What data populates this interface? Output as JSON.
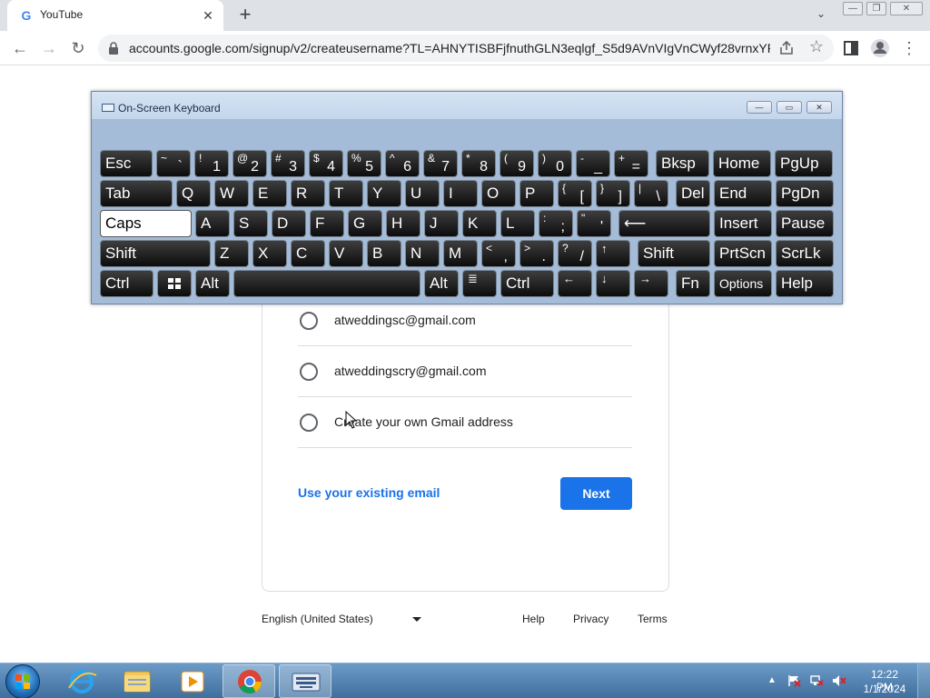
{
  "browser": {
    "tab": {
      "title": "YouTube",
      "favicon": "google-g-icon",
      "close": "✕"
    },
    "new_tab": "+",
    "tab_list": "⌄",
    "window_controls": {
      "minimize": "—",
      "restore": "❐",
      "close": "✕"
    },
    "url": "accounts.google.com/signup/v2/createusername?TL=AHNYTISBFjfnuthGLN3eqlgf_S5d9AVnVIgVnCWyf28vrnxYR...",
    "nav": {
      "back": "←",
      "forward": "→",
      "reload": "↻"
    },
    "star": "☆",
    "menu": "⋮"
  },
  "osk": {
    "title": "On-Screen Keyboard",
    "controls": {
      "minimize": "—",
      "restore": "▭",
      "close": "✕"
    },
    "rows": [
      [
        {
          "l": "Esc",
          "w": 58
        },
        {
          "s": "~",
          "u": "`",
          "w": 38
        },
        {
          "s": "!",
          "u": "1",
          "w": 38
        },
        {
          "s": "@",
          "u": "2",
          "w": 38
        },
        {
          "s": "#",
          "u": "3",
          "w": 38
        },
        {
          "s": "$",
          "u": "4",
          "w": 38
        },
        {
          "s": "%",
          "u": "5",
          "w": 38
        },
        {
          "s": "^",
          "u": "6",
          "w": 38
        },
        {
          "s": "&",
          "u": "7",
          "w": 38
        },
        {
          "s": "*",
          "u": "8",
          "w": 38
        },
        {
          "s": "(",
          "u": "9",
          "w": 38
        },
        {
          "s": ")",
          "u": "0",
          "w": 38
        },
        {
          "s": "-",
          "u": "_",
          "w": 38
        },
        {
          "s": "+",
          "u": "=",
          "w": 38
        },
        {
          "l": "Bksp",
          "w": 59,
          "gap": 4
        },
        {
          "l": "Home",
          "w": 64
        },
        {
          "l": "PgUp",
          "w": 64
        }
      ],
      [
        {
          "l": "Tab",
          "w": 80
        },
        {
          "l": "Q",
          "w": 38
        },
        {
          "l": "W",
          "w": 38
        },
        {
          "l": "E",
          "w": 38
        },
        {
          "l": "R",
          "w": 38
        },
        {
          "l": "T",
          "w": 38
        },
        {
          "l": "Y",
          "w": 38
        },
        {
          "l": "U",
          "w": 38
        },
        {
          "l": "I",
          "w": 38
        },
        {
          "l": "O",
          "w": 38
        },
        {
          "l": "P",
          "w": 38
        },
        {
          "s": "{",
          "u": "[",
          "w": 38
        },
        {
          "s": "}",
          "u": "]",
          "w": 38
        },
        {
          "s": "|",
          "u": "\\",
          "w": 38
        },
        {
          "l": "Del",
          "w": 38,
          "gap": 4
        },
        {
          "l": "End",
          "w": 64
        },
        {
          "l": "PgDn",
          "w": 64
        }
      ],
      [
        {
          "l": "Caps",
          "w": 101,
          "caps": true
        },
        {
          "l": "A",
          "w": 38
        },
        {
          "l": "S",
          "w": 38
        },
        {
          "l": "D",
          "w": 38
        },
        {
          "l": "F",
          "w": 38
        },
        {
          "l": "G",
          "w": 38
        },
        {
          "l": "H",
          "w": 38
        },
        {
          "l": "J",
          "w": 38
        },
        {
          "l": "K",
          "w": 38
        },
        {
          "l": "L",
          "w": 38
        },
        {
          "s": ":",
          "u": ";",
          "w": 38
        },
        {
          "s": "\"",
          "u": "'",
          "w": 38
        },
        {
          "l": "⟵",
          "w": 101,
          "gap": 4
        },
        {
          "l": "Insert",
          "w": 64
        },
        {
          "l": "Pause",
          "w": 64
        }
      ],
      [
        {
          "l": "Shift",
          "w": 122
        },
        {
          "l": "Z",
          "w": 38
        },
        {
          "l": "X",
          "w": 38
        },
        {
          "l": "C",
          "w": 38
        },
        {
          "l": "V",
          "w": 38
        },
        {
          "l": "B",
          "w": 38
        },
        {
          "l": "N",
          "w": 38
        },
        {
          "l": "M",
          "w": 38
        },
        {
          "s": "<",
          "u": ",",
          "w": 38
        },
        {
          "s": ">",
          "u": ".",
          "w": 38
        },
        {
          "s": "?",
          "u": "/",
          "w": 38
        },
        {
          "l": "↑",
          "w": 38,
          "small": true
        },
        {
          "l": "Shift",
          "w": 80,
          "gap": 4
        },
        {
          "l": "PrtScn",
          "w": 64
        },
        {
          "l": "ScrLk",
          "w": 64
        }
      ],
      [
        {
          "l": "Ctrl",
          "w": 59
        },
        {
          "l": "",
          "w": 38,
          "win": true
        },
        {
          "l": "Alt",
          "w": 38
        },
        {
          "l": "",
          "w": 206
        },
        {
          "l": "Alt",
          "w": 38
        },
        {
          "l": "≣",
          "w": 38,
          "small": true
        },
        {
          "l": "Ctrl",
          "w": 59
        },
        {
          "l": "←",
          "w": 38,
          "small": true
        },
        {
          "l": "↓",
          "w": 38,
          "small": true
        },
        {
          "l": "→",
          "w": 38,
          "small": true
        },
        {
          "l": "Fn",
          "w": 38,
          "gap": 4
        },
        {
          "l": "Options",
          "w": 64,
          "tiny": true
        },
        {
          "l": "Help",
          "w": 64
        }
      ]
    ]
  },
  "signup": {
    "options": [
      {
        "label": "atweddingsc@gmail.com"
      },
      {
        "label": "atweddingscry@gmail.com"
      },
      {
        "label": "Create your own Gmail address"
      }
    ],
    "use_existing": "Use your existing email",
    "next": "Next"
  },
  "footer": {
    "language": "English (United States)",
    "links": [
      "Help",
      "Privacy",
      "Terms"
    ]
  },
  "taskbar": {
    "apps": [
      "internet-explorer-icon",
      "file-explorer-icon",
      "media-player-icon",
      "chrome-icon",
      "on-screen-keyboard-icon"
    ],
    "tray_arrow": "▲",
    "time": "12:22 PM",
    "date": "1/1/2024"
  },
  "colors": {
    "accent": "#1a73e8",
    "taskbar": "#4f7fae",
    "osk_frame": "#a4bcd8"
  }
}
